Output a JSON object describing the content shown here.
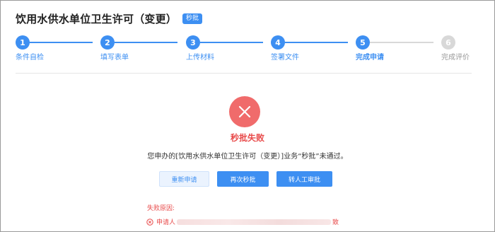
{
  "header": {
    "title": "饮用水供水单位卫生许可（变更）",
    "badge": "秒批"
  },
  "steps": [
    {
      "num": "1",
      "label": "条件自检",
      "state": "done"
    },
    {
      "num": "2",
      "label": "填写表单",
      "state": "done"
    },
    {
      "num": "3",
      "label": "上传材料",
      "state": "done"
    },
    {
      "num": "4",
      "label": "签署文件",
      "state": "done"
    },
    {
      "num": "5",
      "label": "完成申请",
      "state": "current"
    },
    {
      "num": "6",
      "label": "完成评价",
      "state": "pending"
    }
  ],
  "result": {
    "icon": "close-icon",
    "title": "秒批失败",
    "message": "您申办的[饮用水供水单位卫生许可（变更）]业务“秒批”未通过。"
  },
  "buttons": {
    "reapply": "重新申请",
    "retry": "再次秒批",
    "manual": "转人工审批"
  },
  "reason": {
    "label": "失败原因:",
    "prefix": "申请人",
    "suffix": "致"
  },
  "colors": {
    "primary": "#3d8ff2",
    "error": "#e84a4a",
    "error_circle": "#f06b6b",
    "pending": "#d8d8d8"
  }
}
